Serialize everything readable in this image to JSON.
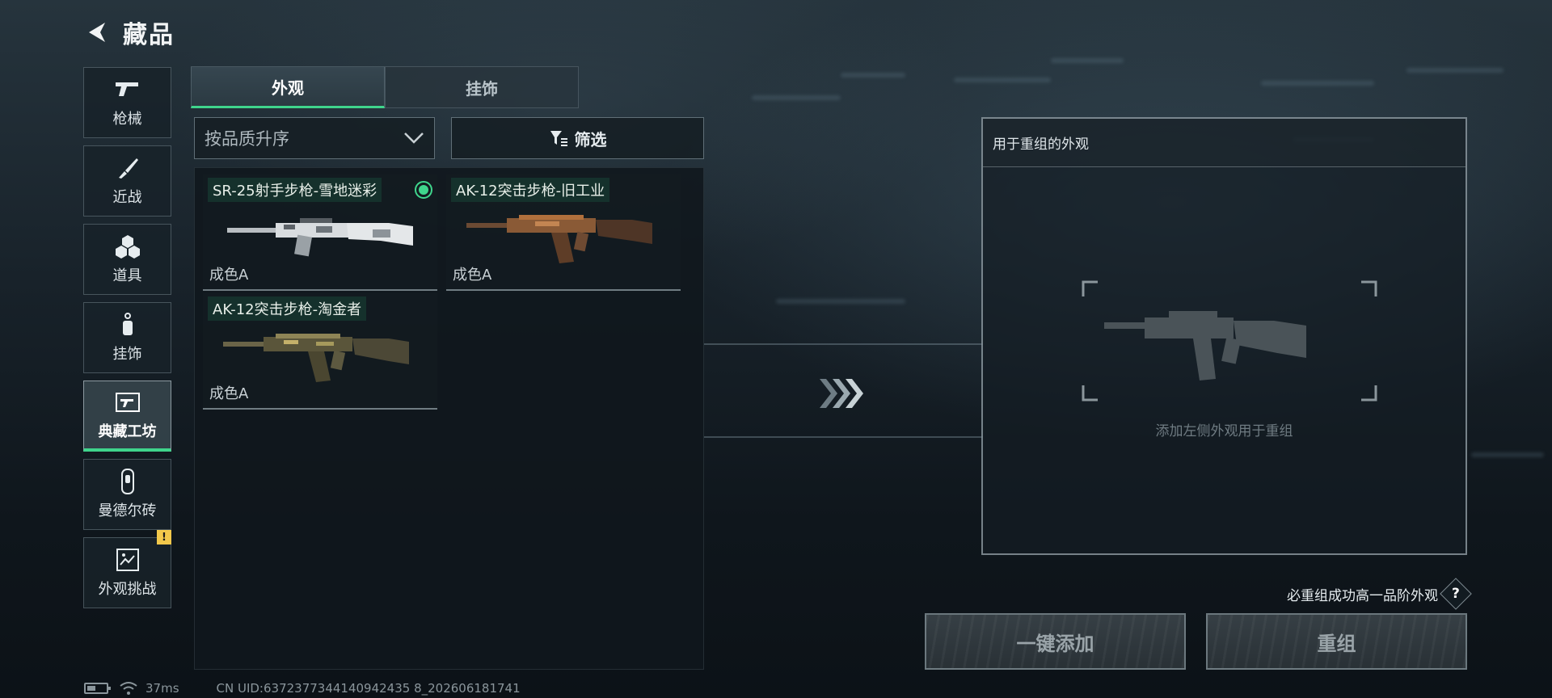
{
  "header": {
    "title": "藏品"
  },
  "sidebar": {
    "items": [
      {
        "label": "枪械",
        "icon": "pistol-icon",
        "active": false,
        "alert": false
      },
      {
        "label": "近战",
        "icon": "knife-icon",
        "active": false,
        "alert": false
      },
      {
        "label": "道具",
        "icon": "grenade-icon",
        "active": false,
        "alert": false
      },
      {
        "label": "挂饰",
        "icon": "charm-icon",
        "active": false,
        "alert": false
      },
      {
        "label": "典藏工坊",
        "icon": "workshop-icon",
        "active": true,
        "alert": false
      },
      {
        "label": "曼德尔砖",
        "icon": "mandel-brick-icon",
        "active": false,
        "alert": false
      },
      {
        "label": "外观挑战",
        "icon": "challenge-icon",
        "active": false,
        "alert": true
      }
    ],
    "alert_symbol": "!"
  },
  "tabs": [
    {
      "label": "外观",
      "active": true
    },
    {
      "label": "挂饰",
      "active": false
    }
  ],
  "sort": {
    "label": "按品质升序"
  },
  "filter": {
    "label": "筛选"
  },
  "skins": [
    {
      "name": "SR-25射手步枪-雪地迷彩",
      "grade": "成色A",
      "equipped": true,
      "finish": "snow-camo"
    },
    {
      "name": "AK-12突击步枪-旧工业",
      "grade": "成色A",
      "equipped": false,
      "finish": "rust"
    },
    {
      "name": "AK-12突击步枪-淘金者",
      "grade": "成色A",
      "equipped": false,
      "finish": "gold-camo"
    }
  ],
  "recombine": {
    "title": "用于重组的外观",
    "placeholder": "添加左侧外观用于重组"
  },
  "hint": {
    "text": "必重组成功高一品阶外观",
    "help_symbol": "?"
  },
  "buttons": {
    "add_all": "一键添加",
    "recombine": "重组"
  },
  "status": {
    "ping": "37ms",
    "uid": "CN UID:6372377344140942435 8_202606181741"
  },
  "colors": {
    "accent_green": "#3fd58c",
    "alert_yellow": "#f2c84b",
    "background": "#0e1419"
  }
}
